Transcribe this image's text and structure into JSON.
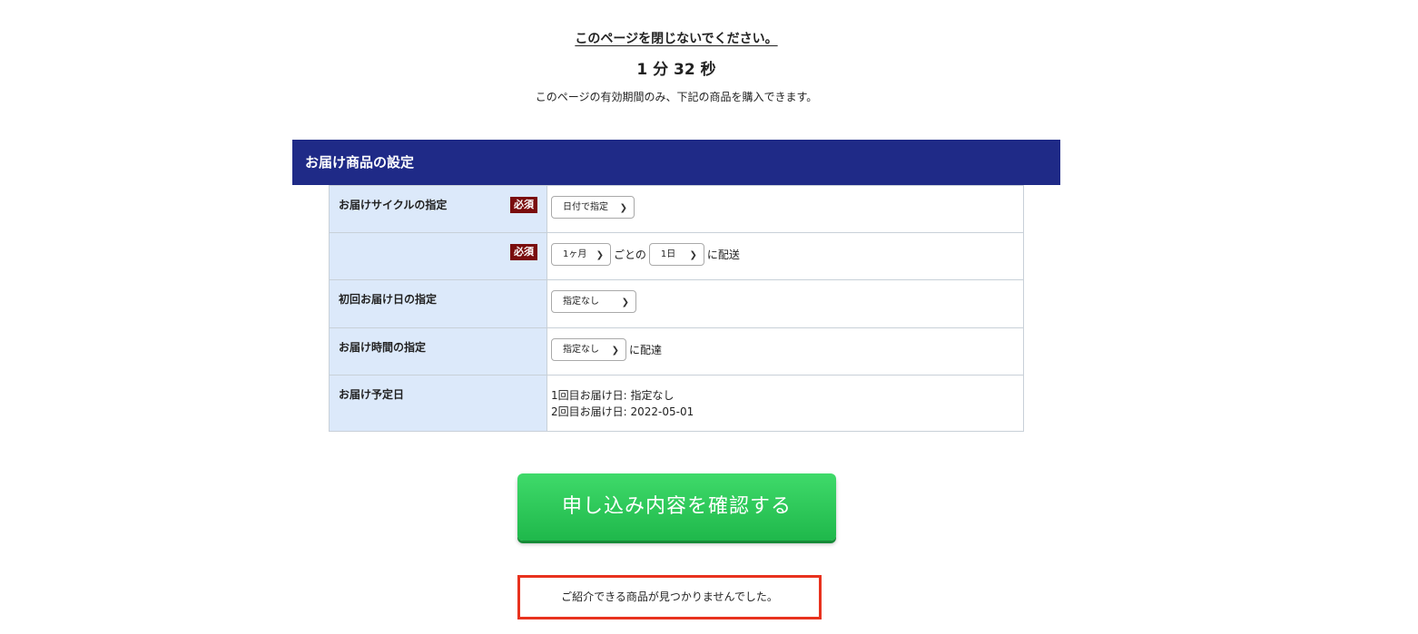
{
  "notice": {
    "title": "このページを閉じないでください。",
    "countdown": "1 分 32 秒",
    "description": "このページの有効期間のみ、下記の商品を購入できます。"
  },
  "section": {
    "title": "お届け商品の設定"
  },
  "required_badge": "必須",
  "rows": {
    "cycle": {
      "label": "お届けサイクルの指定",
      "select_value": "日付で指定"
    },
    "interval": {
      "label": "",
      "month_value": "1ヶ月",
      "between_text": "ごとの",
      "day_value": "1日",
      "suffix_text": "に配送"
    },
    "first_delivery": {
      "label": "初回お届け日の指定",
      "select_value": "指定なし"
    },
    "delivery_time": {
      "label": "お届け時間の指定",
      "select_value": "指定なし",
      "suffix_text": "に配達"
    },
    "schedule": {
      "label": "お届け予定日",
      "line1": "1回目お届け日: 指定なし",
      "line2": "2回目お届け日: 2022-05-01"
    }
  },
  "confirm_button": {
    "label": "申し込み内容を確認する"
  },
  "empty_message": "ご紹介できる商品が見つかりませんでした。",
  "icons": {
    "select_arrow": "chevron-down-icon"
  },
  "colors": {
    "header_bg": "#1f2a87",
    "label_bg": "#dce9fa",
    "required_bg": "#7a0d0d",
    "button_green": "#1fb84b",
    "alert_border": "#e8321e"
  }
}
